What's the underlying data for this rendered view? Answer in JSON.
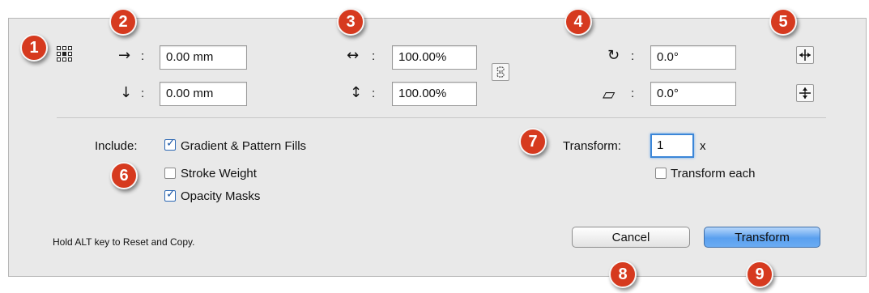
{
  "badges": [
    "1",
    "2",
    "3",
    "4",
    "5",
    "6",
    "7",
    "8",
    "9"
  ],
  "icons": {
    "move_horizontal": "→",
    "move_vertical": "↓",
    "scale_horizontal": "↔",
    "scale_vertical": "↕",
    "rotate": "↻",
    "shear": "▱",
    "colon": ":"
  },
  "move": {
    "horizontal": "0.00 mm",
    "vertical": "0.00 mm"
  },
  "scale": {
    "horizontal": "100.00%",
    "vertical": "100.00%"
  },
  "rotate": {
    "angle": "0.0°"
  },
  "shear": {
    "angle": "0.0°"
  },
  "include": {
    "label": "Include:",
    "options": [
      {
        "label": "Gradient & Pattern Fills",
        "checked": true
      },
      {
        "label": "Stroke Weight",
        "checked": false
      },
      {
        "label": "Opacity Masks",
        "checked": true
      }
    ]
  },
  "transform": {
    "label": "Transform:",
    "count": "1",
    "suffix": "x",
    "each_label": "Transform each",
    "each_checked": false
  },
  "hint": "Hold ALT key to Reset and Copy.",
  "buttons": {
    "cancel": "Cancel",
    "transform": "Transform"
  },
  "colors": {
    "badge": "#d63a1f",
    "primary": "#5aa0ef",
    "panel": "#e9e9e9"
  }
}
